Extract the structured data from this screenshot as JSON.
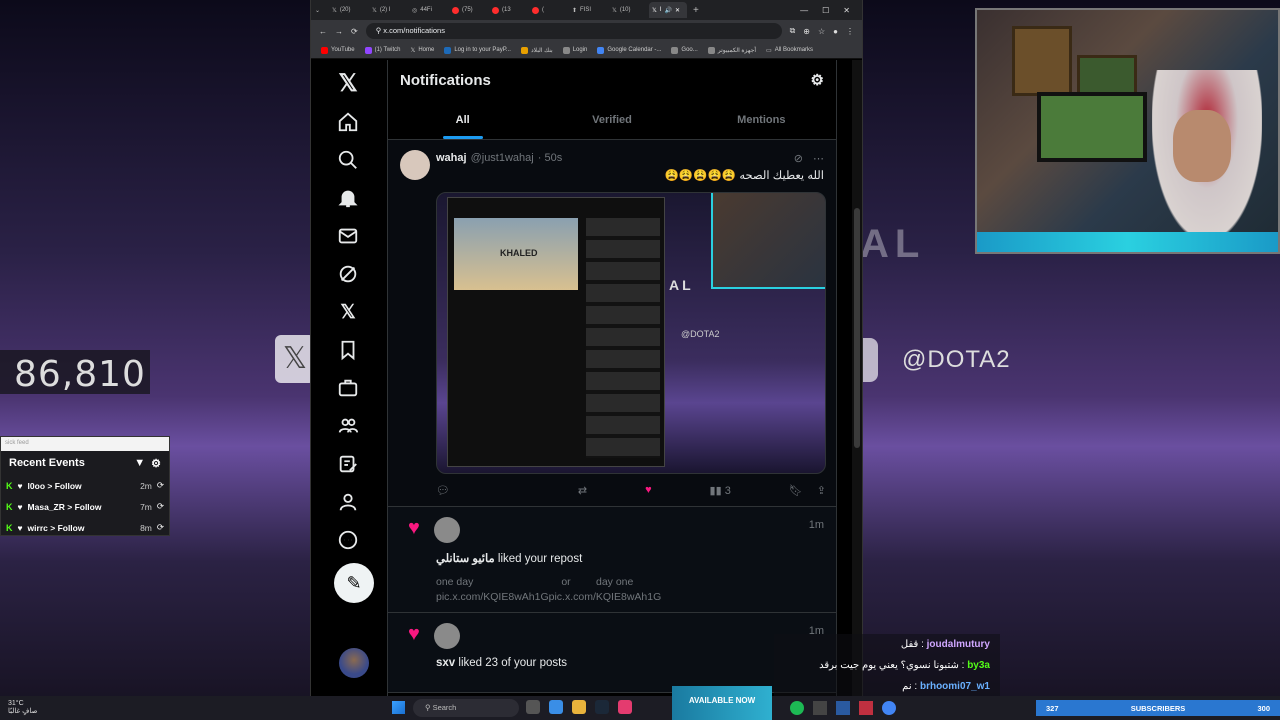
{
  "overlay": {
    "viewer_counter": "86,810",
    "bg_text_al": "AL",
    "bg_text_dota": "@DOTA2",
    "events": {
      "search_placeholder": "sick feed",
      "title": "Recent Events",
      "items": [
        {
          "name": "l0oo",
          "action": "Follow",
          "time": "2m"
        },
        {
          "name": "Masa_ZR",
          "action": "Follow",
          "time": "7m"
        },
        {
          "name": "wirrc",
          "action": "Follow",
          "time": "8m"
        }
      ]
    }
  },
  "browser": {
    "tabs": [
      "(20)",
      "(2) I",
      "44Fi",
      "(75)",
      "(13",
      "(",
      "FISI",
      "(10)",
      "I"
    ],
    "url": "x.com/notifications",
    "bookmarks": [
      "YouTube",
      "(1) Twitch",
      "Home",
      "Log in to your PayP...",
      "بنك البلاد",
      "Login",
      "Google Calendar -...",
      "Goo...",
      "أجهزة الكمبيوتر"
    ],
    "all_bookmarks": "All Bookmarks"
  },
  "x": {
    "header_title": "Notifications",
    "tabs": [
      "All",
      "Verified",
      "Mentions"
    ],
    "post": {
      "name": "wahaj",
      "handle": "@just1wahaj",
      "time": "· 50s",
      "text": "الله يعطيك الصحه 😩😩😩😩😩",
      "media_yt_title": "KHALED",
      "media_al": "AL",
      "media_dota": "@DOTA2",
      "views": "3"
    },
    "notifications": [
      {
        "user": "مائيو ستانلي",
        "action": "liked your repost",
        "time": "1m",
        "quote_words": [
          "one day",
          "or",
          "day one"
        ],
        "quote_links": "pic.x.com/KQIE8wAh1Gpic.x.com/KQIE8wAh1G"
      },
      {
        "user": "sxv",
        "action": "liked 23 of your posts",
        "time": "1m"
      }
    ]
  },
  "chat": [
    {
      "user": "joudalmutury",
      "text": "قفل"
    },
    {
      "user": "by3a",
      "text": "شتبونا نسوي؟ يعني يوم جيت برقد"
    },
    {
      "user": "brhoomi07_w1",
      "text": "نم"
    }
  ],
  "taskbar": {
    "temp": "31°C",
    "weather": "صافٍ غالبًا",
    "search": "Search",
    "subscribers_label": "SUBSCRIBERS",
    "subscribers_left": "327",
    "subscribers_right": "300",
    "ad_text": "AVAILABLE NOW"
  }
}
